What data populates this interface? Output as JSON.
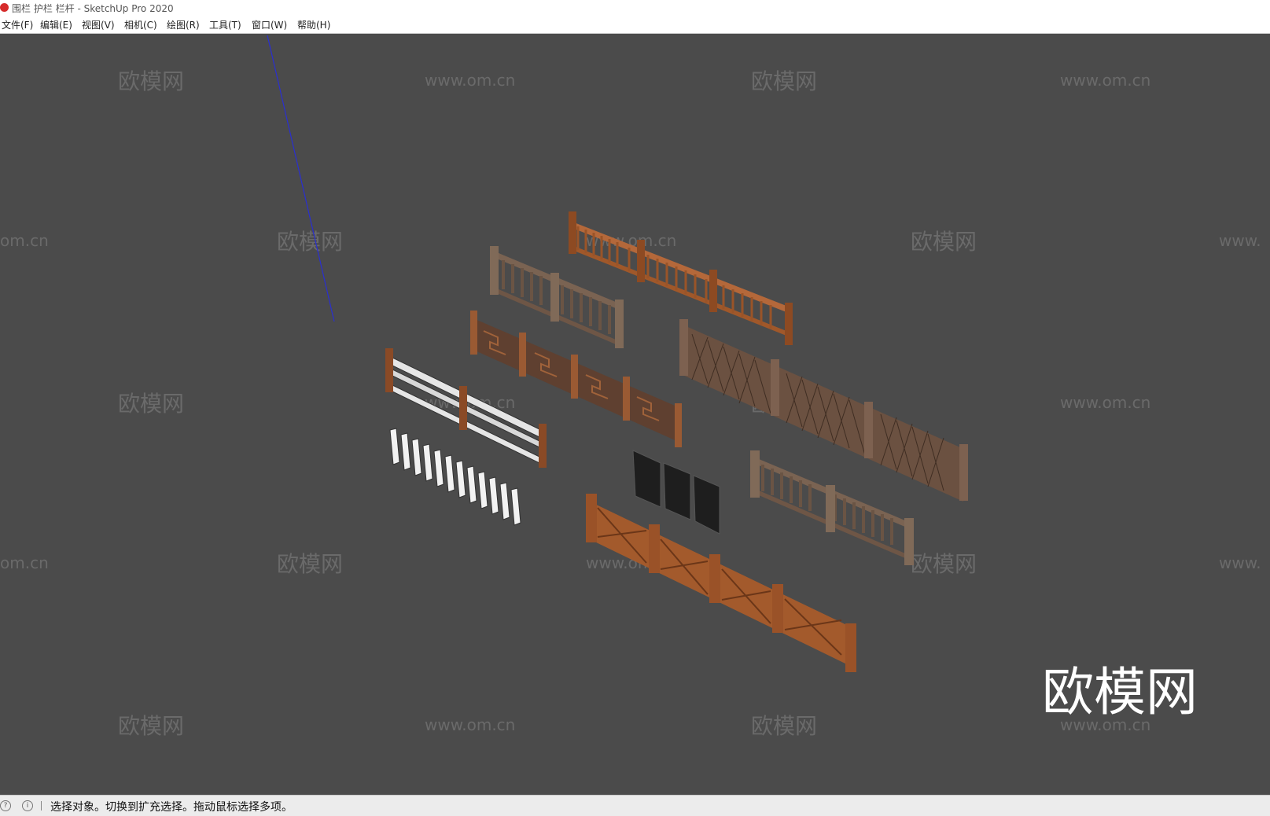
{
  "window": {
    "title": "围栏 护栏 栏杆 - SketchUp Pro 2020"
  },
  "menu": [
    {
      "label": "文件(F)"
    },
    {
      "label": "编辑(E)"
    },
    {
      "label": "视图(V)"
    },
    {
      "label": "相机(C)"
    },
    {
      "label": "绘图(R)"
    },
    {
      "label": "工具(T)"
    },
    {
      "label": "窗口(W)"
    },
    {
      "label": "帮助(H)"
    }
  ],
  "watermark": {
    "brand": "欧模网",
    "url": "www.om.cn",
    "url_partial_left": "om.cn",
    "url_partial_right": "www."
  },
  "status": {
    "message": "选择对象。切换到扩充选择。拖动鼠标选择多项。",
    "icons": [
      "geolocation-icon",
      "info-icon"
    ]
  },
  "colors": {
    "viewport_bg": "#4b4b4b",
    "axis_blue": "#2a2fd0",
    "wood_orange": "#a0582a",
    "wood_brown": "#6e5646",
    "wood_dark": "#5a3b28",
    "watermark": "#6a6a6a"
  }
}
